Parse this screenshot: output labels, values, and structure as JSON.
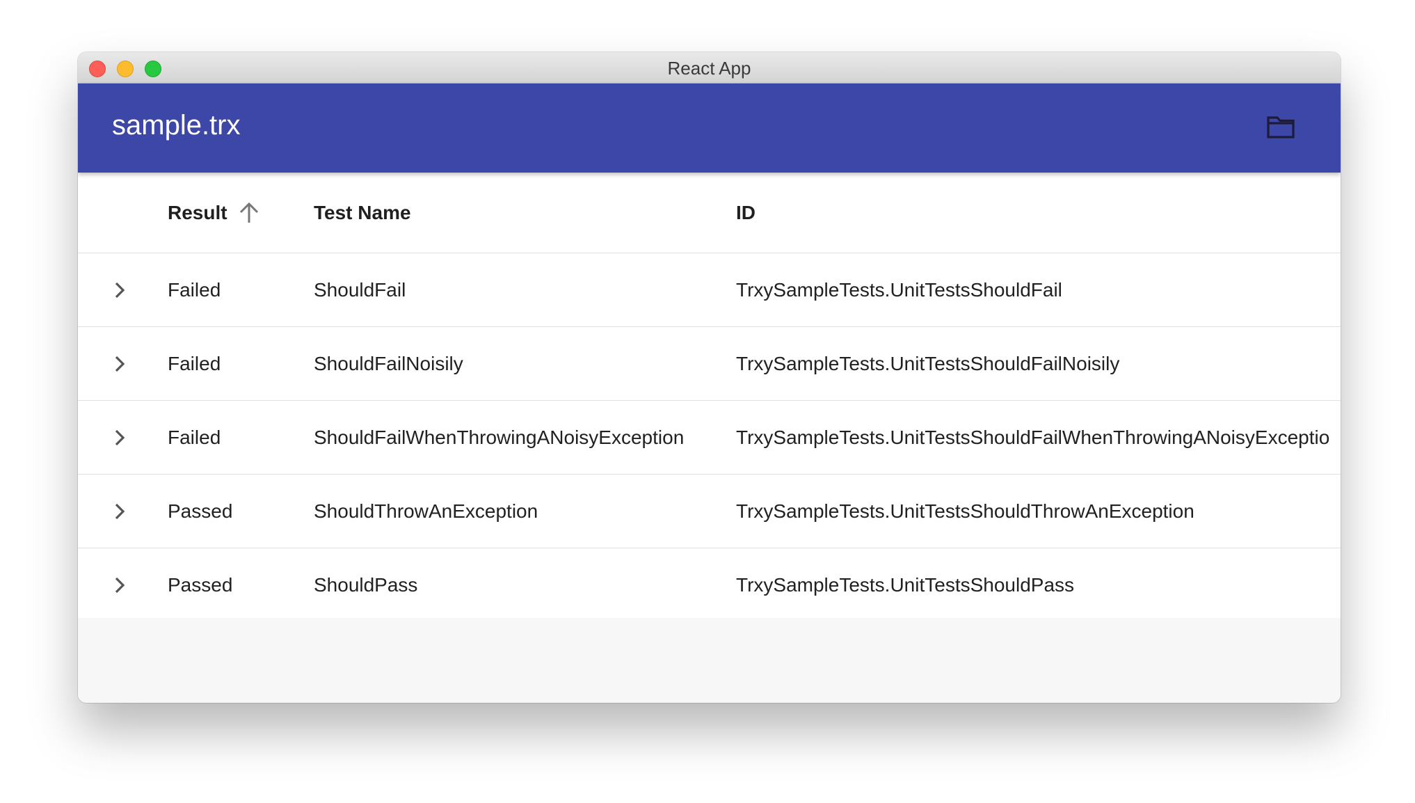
{
  "window": {
    "title": "React App"
  },
  "appbar": {
    "title": "sample.trx",
    "open_icon": "folder-icon"
  },
  "table": {
    "columns": {
      "result": "Result",
      "test_name": "Test Name",
      "id": "ID"
    },
    "sort": {
      "column": "Result",
      "direction": "ascending",
      "icon": "arrow-up-icon"
    },
    "rows": [
      {
        "result": "Failed",
        "name": "ShouldFail",
        "id": "TrxySampleTests.UnitTestsShouldFail"
      },
      {
        "result": "Failed",
        "name": "ShouldFailNoisily",
        "id": "TrxySampleTests.UnitTestsShouldFailNoisily"
      },
      {
        "result": "Failed",
        "name": "ShouldFailWhenThrowingANoisyException",
        "id": "TrxySampleTests.UnitTestsShouldFailWhenThrowingANoisyExceptio"
      },
      {
        "result": "Passed",
        "name": "ShouldThrowAnException",
        "id": "TrxySampleTests.UnitTestsShouldThrowAnException"
      },
      {
        "result": "Passed",
        "name": "ShouldPass",
        "id": "TrxySampleTests.UnitTestsShouldPass"
      }
    ]
  },
  "colors": {
    "appbar": "#3d47a8",
    "close": "#fc5f57",
    "minimize": "#fdbc2e",
    "maximize": "#28c840"
  }
}
